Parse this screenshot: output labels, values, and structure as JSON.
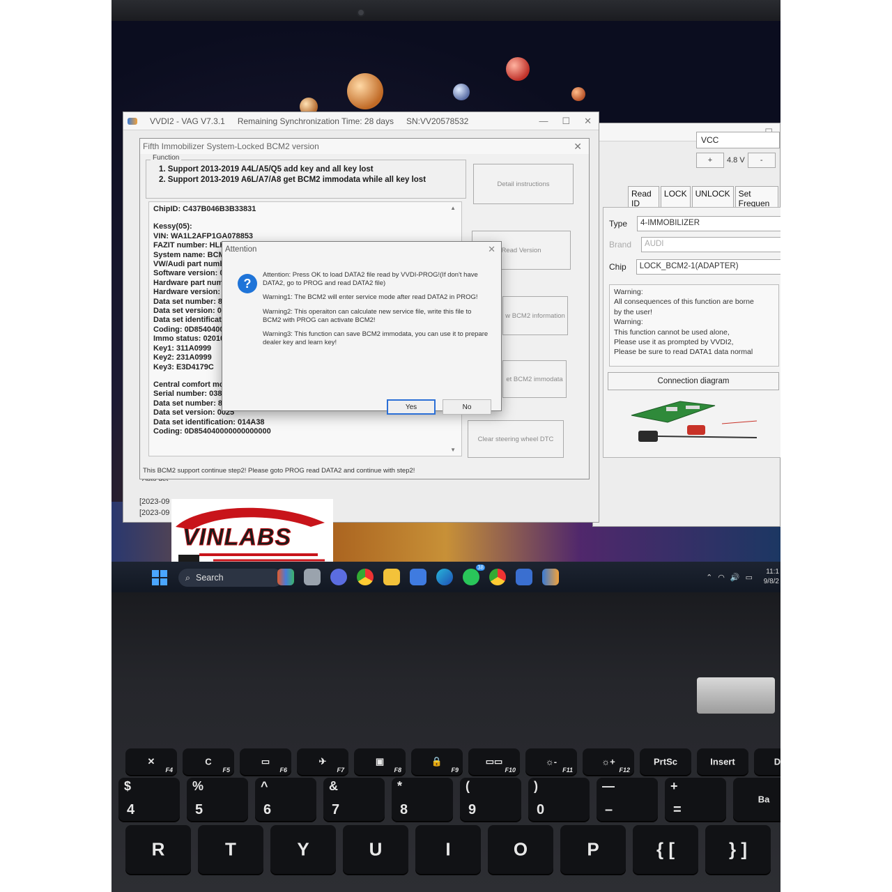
{
  "app": {
    "title": "VVDI2 - VAG V7.3.1",
    "sync": "Remaining Synchronization Time: 28 days",
    "sn": "SN:VV20578532"
  },
  "subwindow": {
    "title": "Fifth Immobilizer System-Locked BCM2 version",
    "function_legend": "Function",
    "function_lines": [
      "1. Support 2013-2019 A4L/A5/Q5 add key and all key lost",
      "2. Support 2013-2019 A6L/A7/A8 get BCM2 immodata while all key lost"
    ],
    "buttons": {
      "detail": "Detail instructions",
      "read_version": "Read Version",
      "bcm2_info": "w BCM2 information",
      "bcm2_immodata": "et BCM2 immodata",
      "clear_dtc": "Clear steering wheel DTC"
    },
    "info_lines": [
      "ChipID: C437B046B3B33831",
      "",
      "Kessy(05):",
      "VIN: WA1L2AFP1GA078853",
      "FAZIT number: HLH",
      "System name: BCM",
      "VW/Audi part numb",
      "Software version: 0",
      "Hardware part num",
      "Hardware version: ",
      "Data set number: 8",
      "Data set version: 0",
      "Data set identificati",
      "Coding: 0D8540400",
      "Immo status: 02010",
      "Key1: 311A0999",
      "Key2: 231A0999",
      "Key3: E3D4179C",
      "",
      "Central comfort mo",
      "Serial number: 0383",
      "Data set number: 8",
      "Data set version: 0025",
      "Data set identification: 014A38",
      "Coding: 0D854040000000000000"
    ],
    "status": "This BCM2 support continue step2! Please goto PROG read DATA2 and continue with step2!"
  },
  "dialog": {
    "title": "Attention",
    "icon": "question-icon",
    "paragraphs": [
      "Attention: Press OK to load DATA2 file read by VVDI-PROG!(If don't have DATA2, go to PROG and read DATA2 file)",
      "Warning1: The BCM2 will enter service mode after read DATA2 in PROG!",
      "Warning2: This operaiton can calculate new service file, write this file to BCM2 with PROG can activate BCM2!",
      "Warning3: This function can save BCM2 immodata, you can use it to prepare dealer key and learn key!"
    ],
    "yes_label": "Yes",
    "no_label": "No"
  },
  "right_panel": {
    "vcc": "VCC",
    "plus": "+",
    "voltage": "4.8 V",
    "minus": "-",
    "tabs": [
      "Read ID",
      "LOCK",
      "UNLOCK",
      "Set Frequen"
    ],
    "type_label": "Type",
    "type_value": "4-IMMOBILIZER",
    "brand_label": "Brand",
    "brand_value": "AUDI",
    "chip_label": "Chip",
    "chip_value": "LOCK_BCM2-1(ADAPTER)",
    "warnings": [
      "Warning:",
      " All consequences of this function are borne",
      " by the user!",
      "Warning:",
      " This function cannot be used alone,",
      " Please use it as prompted by VVDI2,",
      " Please be sure to read DATA1 data normal"
    ],
    "connection_label": "Connection diagram"
  },
  "main_left": {
    "auto_detect": "Auto det",
    "log_lines": [
      "[2023-09",
      "[2023-09"
    ]
  },
  "watermark": {
    "text": "VINLABS"
  },
  "taskbar": {
    "search_label": "Search",
    "badge": "38",
    "time": "11:1",
    "date": "9/8/2"
  },
  "keyboard": {
    "fn_row": [
      {
        "sym": "✕",
        "fn": "F4"
      },
      {
        "sym": "C",
        "fn": "F5"
      },
      {
        "sym": "▭",
        "fn": "F6"
      },
      {
        "sym": "✈",
        "fn": "F7"
      },
      {
        "sym": "▣",
        "fn": "F8"
      },
      {
        "sym": "🔒",
        "fn": "F9"
      },
      {
        "sym": "▭▭",
        "fn": "F10"
      },
      {
        "sym": "☼-",
        "fn": "F11"
      },
      {
        "sym": "☼+",
        "fn": "F12"
      },
      {
        "sym": "PrtSc",
        "fn": ""
      },
      {
        "sym": "Insert",
        "fn": ""
      },
      {
        "sym": "De",
        "fn": ""
      }
    ],
    "num_row": [
      {
        "top": "$",
        "bot": "4"
      },
      {
        "top": "%",
        "bot": "5"
      },
      {
        "top": "^",
        "bot": "6"
      },
      {
        "top": "&",
        "bot": "7"
      },
      {
        "top": "*",
        "bot": "8"
      },
      {
        "top": "(",
        "bot": "9"
      },
      {
        "top": ")",
        "bot": "0"
      },
      {
        "top": "—",
        "bot": "–"
      },
      {
        "top": "+",
        "bot": "="
      },
      {
        "top": "Ba",
        "bot": ""
      }
    ],
    "letter_row": [
      "R",
      "T",
      "Y",
      "U",
      "I",
      "O",
      "P",
      "{ [",
      "} ]"
    ]
  }
}
